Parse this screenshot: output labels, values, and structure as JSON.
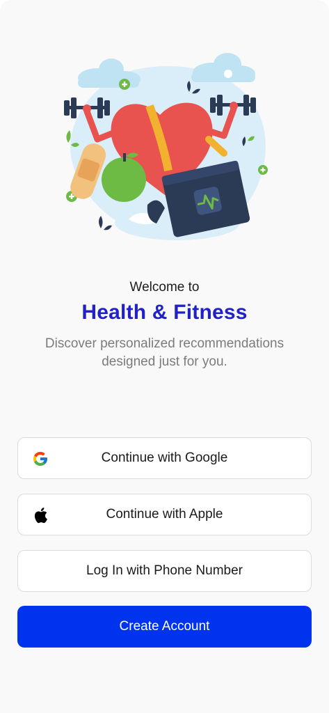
{
  "welcome": {
    "greeting": "Welcome to",
    "app_name": "Health & Fitness",
    "description": "Discover personalized recommendations designed just for you."
  },
  "buttons": {
    "google": "Continue with Google",
    "apple": "Continue with Apple",
    "phone": "Log In with Phone Number",
    "create": "Create Account"
  },
  "icons": {
    "google": "google-icon",
    "apple": "apple-icon"
  },
  "colors": {
    "brand_title": "#2121c8",
    "primary_button": "#0033ee",
    "illustration_heart": "#e8524f",
    "illustration_apple": "#6dbb45",
    "illustration_box": "#2b3a55"
  }
}
